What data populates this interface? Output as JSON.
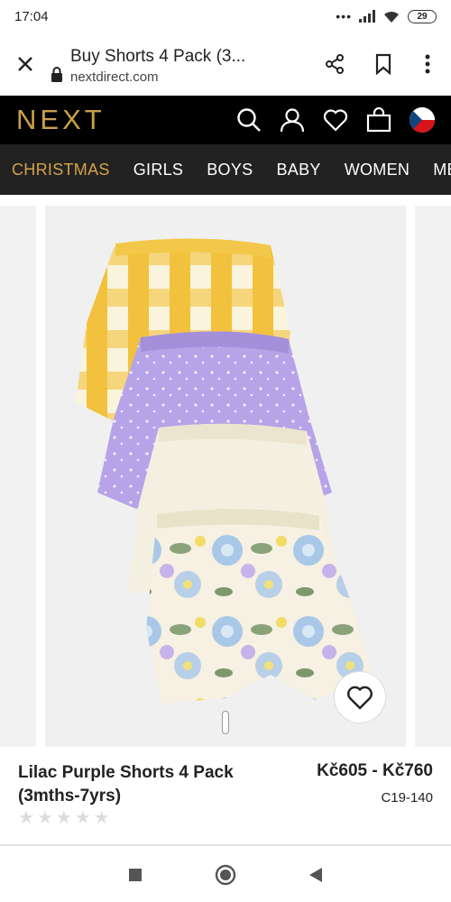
{
  "status": {
    "time": "17:04",
    "battery": "29"
  },
  "browser": {
    "title": "Buy Shorts 4 Pack (3...",
    "domain": "nextdirect.com"
  },
  "header": {
    "logo": "NEXT"
  },
  "nav": {
    "items": [
      "CHRISTMAS",
      "GIRLS",
      "BOYS",
      "BABY",
      "WOMEN",
      "MEN"
    ]
  },
  "product": {
    "name": "Lilac Purple Shorts 4 Pack (3mths-7yrs)",
    "price": "Kč605 - Kč760",
    "code": "C19-140",
    "rating_stars": 0
  },
  "colors": {
    "brand_gold": "#c9a14a",
    "nav_active": "#d4a24a",
    "header_bg": "#000000",
    "nav_bg": "#222222"
  }
}
